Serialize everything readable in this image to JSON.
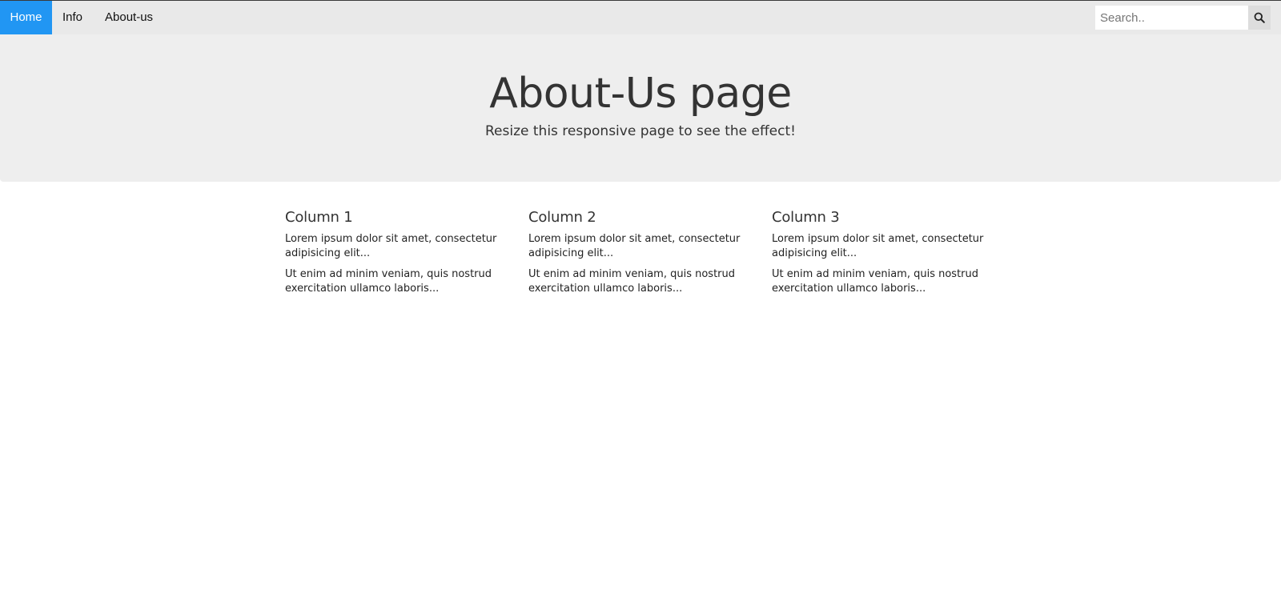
{
  "nav": {
    "items": [
      {
        "label": "Home",
        "active": true
      },
      {
        "label": "Info",
        "active": false
      },
      {
        "label": "About-us",
        "active": false
      }
    ],
    "search": {
      "placeholder": "Search..",
      "value": "",
      "icon": "search-icon"
    },
    "accent_color": "#2196F3"
  },
  "hero": {
    "title": "About-Us page",
    "subtitle": "Resize this responsive page to see the effect!"
  },
  "columns": [
    {
      "heading": "Column 1",
      "paragraphs": [
        "Lorem ipsum dolor sit amet, consectetur adipisicing elit...",
        "Ut enim ad minim veniam, quis nostrud exercitation ullamco laboris..."
      ]
    },
    {
      "heading": "Column 2",
      "paragraphs": [
        "Lorem ipsum dolor sit amet, consectetur adipisicing elit...",
        "Ut enim ad minim veniam, quis nostrud exercitation ullamco laboris..."
      ]
    },
    {
      "heading": "Column 3",
      "paragraphs": [
        "Lorem ipsum dolor sit amet, consectetur adipisicing elit...",
        "Ut enim ad minim veniam, quis nostrud exercitation ullamco laboris..."
      ]
    }
  ]
}
